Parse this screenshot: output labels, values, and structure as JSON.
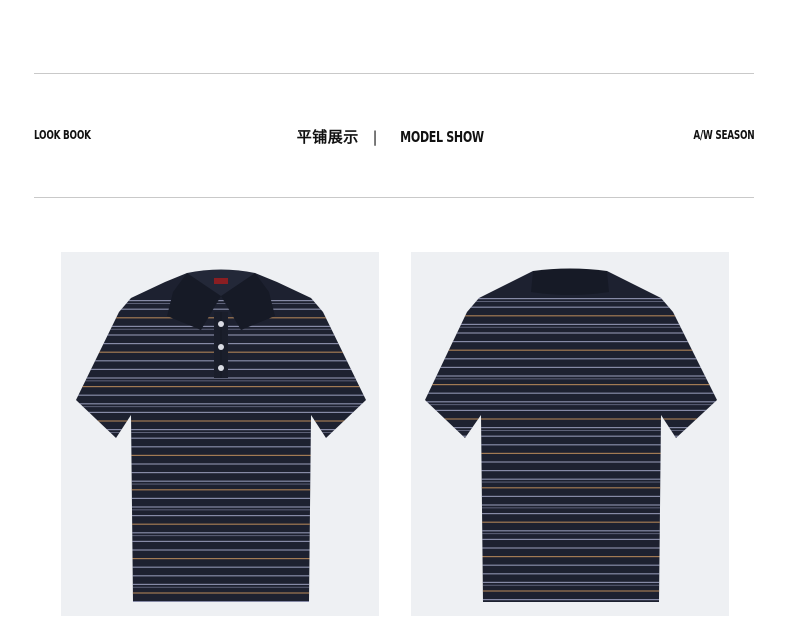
{
  "header": {
    "left_label": "LOOK BOOK",
    "title_cn": "平铺展示",
    "separator": "|",
    "title_en": "MODEL SHOW",
    "right_label": "A/W SEASON"
  },
  "products": [
    {
      "view": "front"
    },
    {
      "view": "back"
    }
  ],
  "colors": {
    "shirt": "#1d2130",
    "stripe_light": "#a9aecd",
    "stripe_tan": "#b98a5a",
    "panel_bg": "#eef0f3",
    "label_red": "#8a1e22"
  }
}
